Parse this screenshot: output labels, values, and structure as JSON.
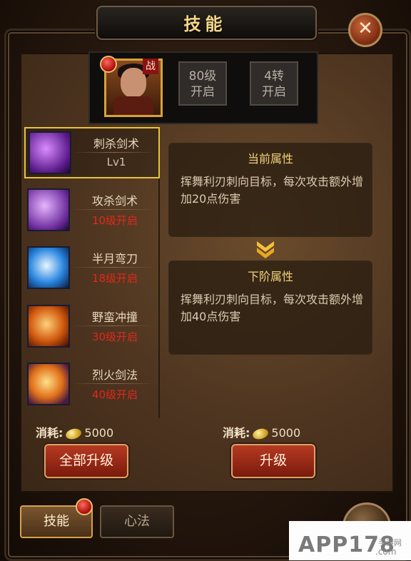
{
  "window": {
    "title": "技能",
    "close_glyph": "✕"
  },
  "character": {
    "class_badge": "战"
  },
  "unlocks": [
    {
      "line1": "80级",
      "line2": "开启"
    },
    {
      "line1": "4转",
      "line2": "开启"
    }
  ],
  "skills": [
    {
      "name": "刺杀剑术",
      "sub": "Lv1",
      "sub_color": "#cfc3ae",
      "icon": "purple-sword-icon",
      "selected": true
    },
    {
      "name": "攻杀剑术",
      "sub": "10级开启",
      "sub_color": "#e0281c",
      "icon": "violet-blade-icon",
      "selected": false
    },
    {
      "name": "半月弯刀",
      "sub": "18级开启",
      "sub_color": "#e0281c",
      "icon": "blue-crescent-icon",
      "selected": false
    },
    {
      "name": "野蛮冲撞",
      "sub": "30级开启",
      "sub_color": "#e0281c",
      "icon": "fire-charge-icon",
      "selected": false
    },
    {
      "name": "烈火剑法",
      "sub": "40级开启",
      "sub_color": "#e0281c",
      "icon": "flame-sword-icon",
      "selected": false
    }
  ],
  "current_attr": {
    "title": "当前属性",
    "text": "挥舞利刃刺向目标，每次攻击额外增加20点伤害"
  },
  "next_attr": {
    "title": "下阶属性",
    "text": "挥舞利刃刺向目标，每次攻击额外增加40点伤害"
  },
  "cost_left": {
    "label": "消耗:",
    "value": "5000"
  },
  "cost_right": {
    "label": "消耗:",
    "value": "5000"
  },
  "buttons": {
    "upgrade_all": "全部升级",
    "upgrade": "升级"
  },
  "tabs": [
    {
      "label": "技能",
      "active": true
    },
    {
      "label": "心法",
      "active": false
    }
  ],
  "watermark": {
    "main": "APP178",
    "sub": "手游网",
    "dom": ".com"
  },
  "colors": {
    "gold": "#f2d37a",
    "locked_red": "#e0281c"
  }
}
